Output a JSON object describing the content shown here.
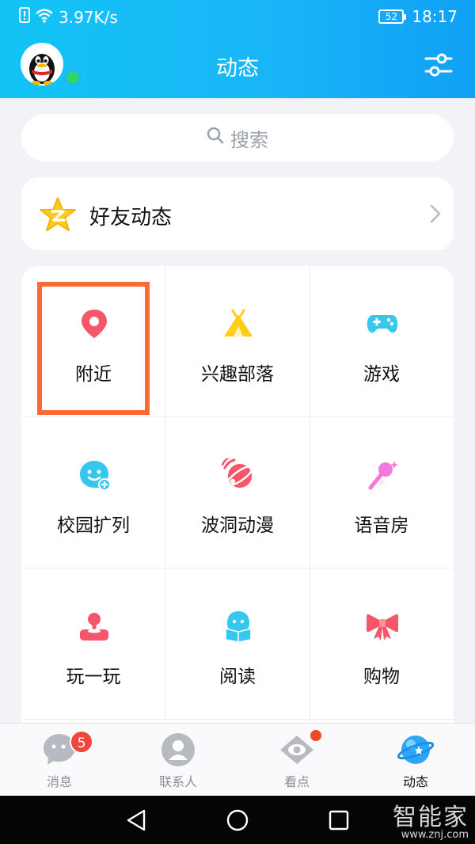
{
  "status_bar": {
    "network_speed": "3.97K/s",
    "battery": "52",
    "time": "18:17"
  },
  "header": {
    "title": "动态",
    "avatar_icon": "qq-penguin-avatar",
    "filter_icon": "filter-sliders-icon"
  },
  "search": {
    "placeholder": "搜索"
  },
  "friend_feed": {
    "label": "好友动态",
    "icon": "qzone-star-icon"
  },
  "grid": {
    "items": [
      {
        "label": "附近",
        "icon": "location-pin-icon",
        "color": "#f5566a"
      },
      {
        "label": "兴趣部落",
        "icon": "tribe-tent-icon",
        "color": "#ffcc1a"
      },
      {
        "label": "游戏",
        "icon": "gamepad-icon",
        "color": "#36c7ee"
      },
      {
        "label": "校园扩列",
        "icon": "campus-face-icon",
        "color": "#36c7ee"
      },
      {
        "label": "波洞动漫",
        "icon": "anime-planet-icon",
        "color": "#f5566a"
      },
      {
        "label": "语音房",
        "icon": "microphone-icon",
        "color": "#f278d9"
      },
      {
        "label": "玩一玩",
        "icon": "joystick-icon",
        "color": "#f5566a"
      },
      {
        "label": "阅读",
        "icon": "reading-icon",
        "color": "#36c7ee"
      },
      {
        "label": "购物",
        "icon": "bow-icon",
        "color": "#f5566a"
      }
    ],
    "highlight_color": "#ff6a34"
  },
  "tabbar": {
    "tabs": [
      {
        "label": "消息",
        "icon": "message-icon",
        "badge": "5"
      },
      {
        "label": "联系人",
        "icon": "contacts-icon"
      },
      {
        "label": "看点",
        "icon": "eye-icon"
      },
      {
        "label": "动态",
        "icon": "planet-icon",
        "active": true
      }
    ]
  },
  "watermark": {
    "title": "智能家",
    "url": "www.znj.com"
  }
}
